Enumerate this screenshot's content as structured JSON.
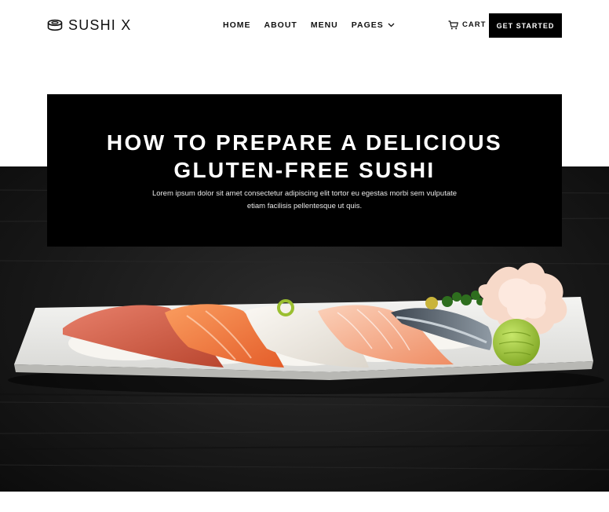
{
  "header": {
    "brand": "SUSHI X",
    "menu": [
      {
        "label": "HOME"
      },
      {
        "label": "ABOUT"
      },
      {
        "label": "MENU"
      },
      {
        "label": "PAGES"
      }
    ],
    "cart_label": "CART",
    "cta_label": "GET STARTED"
  },
  "hero": {
    "title_line1": "HOW TO PREPARE A DELICIOUS",
    "title_line2": "GLUTEN-FREE SUSHI",
    "description": "Lorem ipsum dolor sit amet consectetur adipiscing elit tortor eu egestas morbi sem vulputate etiam facilisis pellentesque ut quis.",
    "image": "sushi-platter-photo"
  },
  "colors": {
    "text": "#111111",
    "button_bg": "#000000",
    "button_text": "#ffffff",
    "hero_bg": "#1a1a1a"
  }
}
